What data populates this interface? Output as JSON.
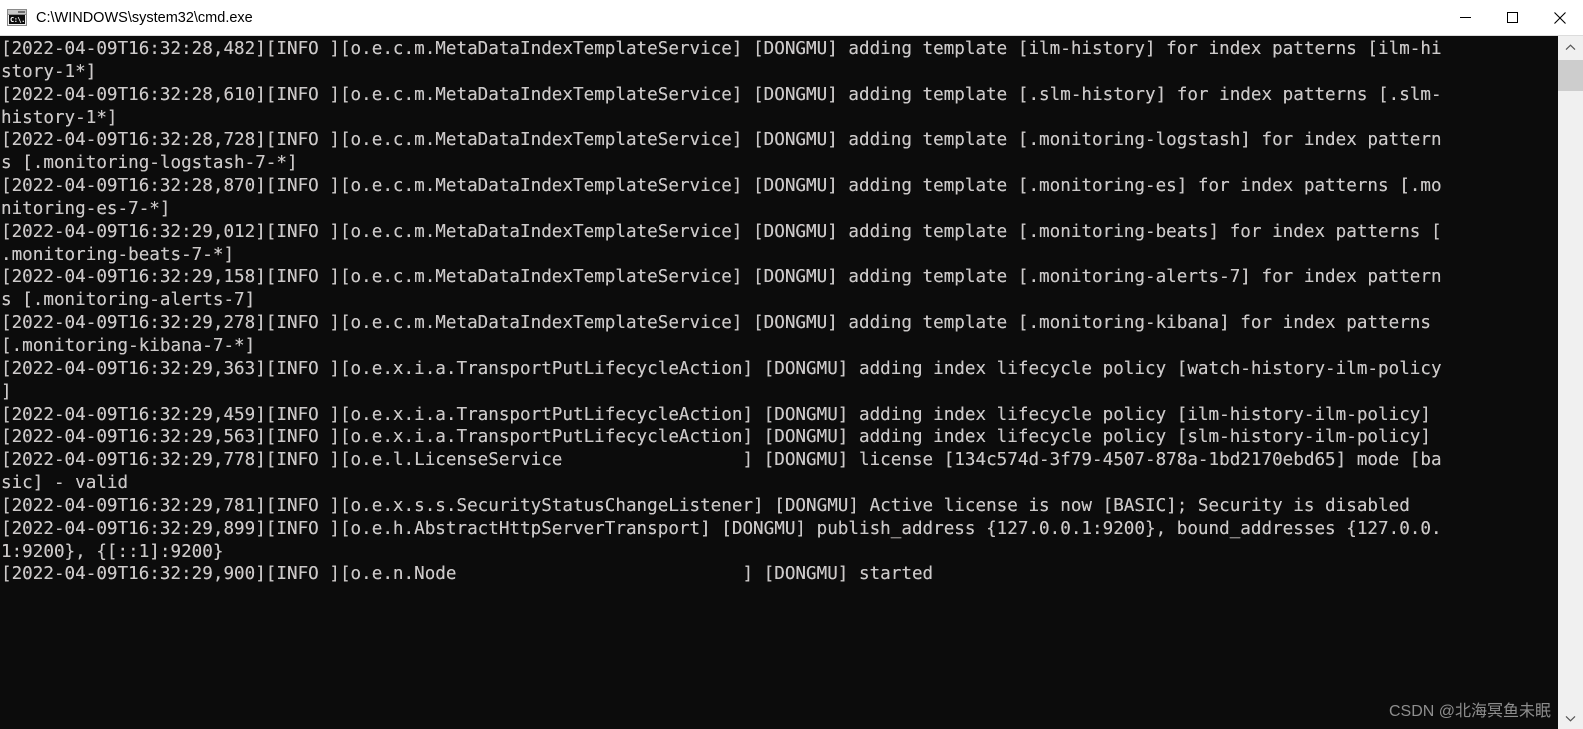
{
  "window": {
    "title": "C:\\WINDOWS\\system32\\cmd.exe",
    "icon_name": "cmd-icon",
    "icon_glyph": "C:\\.",
    "background_color": "#0c0c0c",
    "text_color": "#ccc9c9",
    "titlebar_color": "#ffffff"
  },
  "controls": {
    "minimize_label": "Minimize",
    "maximize_label": "Maximize",
    "close_label": "Close"
  },
  "scrollbar": {
    "up_arrow_label": "Scroll up",
    "down_arrow_label": "Scroll down",
    "thumb_label": "Scroll thumb"
  },
  "console": {
    "lines": [
      "[2022-04-09T16:32:28,482][INFO ][o.e.c.m.MetaDataIndexTemplateService] [DONGMU] adding template [ilm-history] for index patterns [ilm-history-1*]",
      "[2022-04-09T16:32:28,610][INFO ][o.e.c.m.MetaDataIndexTemplateService] [DONGMU] adding template [.slm-history] for index patterns [.slm-history-1*]",
      "[2022-04-09T16:32:28,728][INFO ][o.e.c.m.MetaDataIndexTemplateService] [DONGMU] adding template [.monitoring-logstash] for index patterns [.monitoring-logstash-7-*]",
      "[2022-04-09T16:32:28,870][INFO ][o.e.c.m.MetaDataIndexTemplateService] [DONGMU] adding template [.monitoring-es] for index patterns [.monitoring-es-7-*]",
      "[2022-04-09T16:32:29,012][INFO ][o.e.c.m.MetaDataIndexTemplateService] [DONGMU] adding template [.monitoring-beats] for index patterns [.monitoring-beats-7-*]",
      "[2022-04-09T16:32:29,158][INFO ][o.e.c.m.MetaDataIndexTemplateService] [DONGMU] adding template [.monitoring-alerts-7] for index patterns [.monitoring-alerts-7]",
      "[2022-04-09T16:32:29,278][INFO ][o.e.c.m.MetaDataIndexTemplateService] [DONGMU] adding template [.monitoring-kibana] for index patterns [.monitoring-kibana-7-*]",
      "[2022-04-09T16:32:29,363][INFO ][o.e.x.i.a.TransportPutLifecycleAction] [DONGMU] adding index lifecycle policy [watch-history-ilm-policy]",
      "[2022-04-09T16:32:29,459][INFO ][o.e.x.i.a.TransportPutLifecycleAction] [DONGMU] adding index lifecycle policy [ilm-history-ilm-policy]",
      "[2022-04-09T16:32:29,563][INFO ][o.e.x.i.a.TransportPutLifecycleAction] [DONGMU] adding index lifecycle policy [slm-history-ilm-policy]",
      "[2022-04-09T16:32:29,778][INFO ][o.e.l.LicenseService                 ] [DONGMU] license [134c574d-3f79-4507-878a-1bd2170ebd65] mode [basic] - valid",
      "[2022-04-09T16:32:29,781][INFO ][o.e.x.s.s.SecurityStatusChangeListener] [DONGMU] Active license is now [BASIC]; Security is disabled",
      "[2022-04-09T16:32:29,899][INFO ][o.e.h.AbstractHttpServerTransport] [DONGMU] publish_address {127.0.0.1:9200}, bound_addresses {127.0.0.1:9200}, {[::1]:9200}",
      "[2022-04-09T16:32:29,900][INFO ][o.e.n.Node                           ] [DONGMU] started"
    ]
  },
  "watermark": {
    "text": "CSDN @北海冥鱼未眠"
  }
}
